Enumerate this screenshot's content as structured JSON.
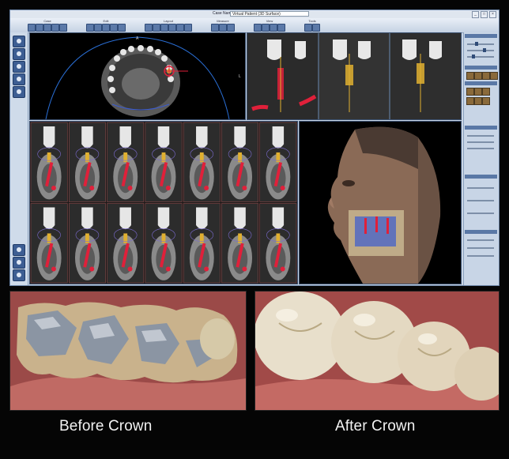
{
  "app": {
    "case_label": "Case Name",
    "case_value": "Virtual Patient (3D Surface)",
    "window_buttons": [
      "_",
      "□",
      "×"
    ],
    "toolbar_groups": [
      {
        "name": "Case",
        "icons": 5
      },
      {
        "name": "Edit",
        "icons": 5
      },
      {
        "name": "Layout",
        "icons": 6
      },
      {
        "name": "Measure",
        "icons": 3
      },
      {
        "name": "View",
        "icons": 4
      },
      {
        "name": "Tools",
        "icons": 2
      }
    ],
    "left_tools": [
      "patient-icon",
      "scan-icon",
      "ct-icon",
      "nerve-icon",
      "implant-icon"
    ],
    "left_bottom_tools": [
      "back-icon",
      "undo-icon",
      "exit-icon"
    ]
  },
  "panels": {
    "axial": {
      "orientation_top": "A",
      "orientation_right": "L"
    },
    "cross_sections": {
      "rows": 2,
      "columns": 7
    }
  },
  "photos": {
    "before_caption": "Before Crown",
    "after_caption": "After Crown"
  },
  "colors": {
    "window_bg": "#c9d6e6",
    "implant_red": "#e0203a",
    "implant_gold": "#e0b030",
    "nerve_blue": "#3a5bd0"
  }
}
